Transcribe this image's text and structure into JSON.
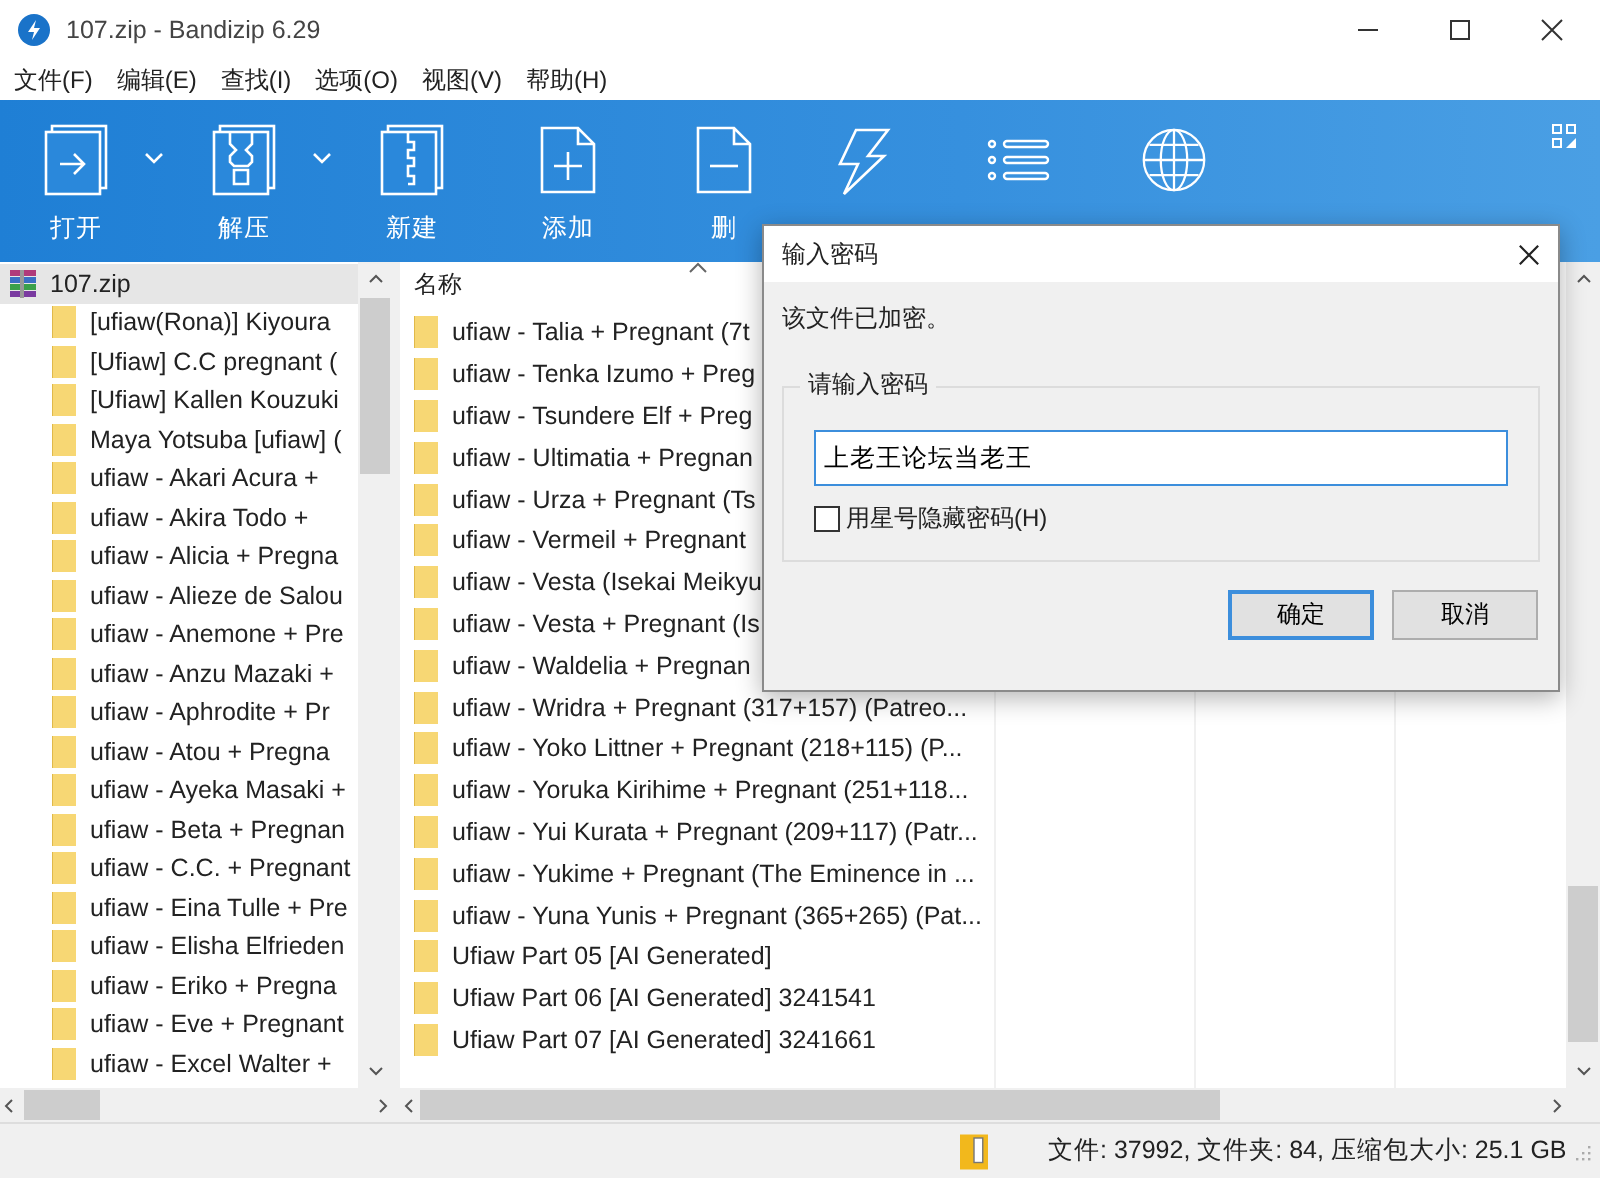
{
  "window": {
    "title": "107.zip - Bandizip 6.29"
  },
  "menu": [
    "文件(F)",
    "编辑(E)",
    "查找(I)",
    "选项(O)",
    "视图(V)",
    "帮助(H)"
  ],
  "toolbar": [
    {
      "label": "打开",
      "has_menu": true
    },
    {
      "label": "解压",
      "has_menu": true
    },
    {
      "label": "新建",
      "has_menu": false
    },
    {
      "label": "添加",
      "has_menu": false
    },
    {
      "label": "删",
      "has_menu": false
    }
  ],
  "tree": {
    "root": {
      "label": "107.zip",
      "selected": true
    },
    "children": [
      {
        "label": "[ufiaw(Rona)] Kiyoura",
        "selected": false
      },
      {
        "label": "[Ufiaw] C.C pregnant (",
        "selected": false
      },
      {
        "label": "[Ufiaw] Kallen Kouzuki",
        "selected": false
      },
      {
        "label": "Maya Yotsuba [ufiaw] (",
        "selected": false
      },
      {
        "label": "ufiaw - Akari Acura +",
        "selected": false
      },
      {
        "label": "ufiaw - Akira Todo +",
        "selected": false
      },
      {
        "label": "ufiaw - Alicia + Pregna",
        "selected": false
      },
      {
        "label": "ufiaw - Alieze de Salou",
        "selected": false
      },
      {
        "label": "ufiaw - Anemone + Pre",
        "selected": false
      },
      {
        "label": "ufiaw - Anzu Mazaki +",
        "selected": false
      },
      {
        "label": "ufiaw - Aphrodite + Pr",
        "selected": false
      },
      {
        "label": "ufiaw - Atou + Pregna",
        "selected": false
      },
      {
        "label": "ufiaw - Ayeka Masaki +",
        "selected": false
      },
      {
        "label": "ufiaw - Beta + Pregnan",
        "selected": false
      },
      {
        "label": "ufiaw - C.C. + Pregnant",
        "selected": false
      },
      {
        "label": "ufiaw - Eina Tulle + Pre",
        "selected": false
      },
      {
        "label": "ufiaw - Elisha Elfrieden",
        "selected": false
      },
      {
        "label": "ufiaw - Eriko + Pregna",
        "selected": false
      },
      {
        "label": "ufiaw - Eve + Pregnant",
        "selected": false
      },
      {
        "label": "ufiaw - Excel Walter +",
        "selected": false
      }
    ]
  },
  "file_list": {
    "columns": [
      "名称"
    ],
    "rows": [
      "ufiaw - Talia + Pregnant (7t",
      "ufiaw - Tenka Izumo + Preg",
      "ufiaw - Tsundere Elf + Preg",
      "ufiaw - Ultimatia + Pregnan",
      "ufiaw - Urza + Pregnant (Ts",
      "ufiaw - Vermeil + Pregnant",
      "ufiaw - Vesta (Isekai Meikyu",
      "ufiaw - Vesta + Pregnant (Is",
      "ufiaw - Waldelia + Pregnan",
      "ufiaw - Wridra + Pregnant (317+157) (Patreo...",
      "ufiaw - Yoko Littner + Pregnant (218+115) (P...",
      "ufiaw - Yoruka Kirihime + Pregnant (251+118...",
      "ufiaw - Yui Kurata + Pregnant (209+117) (Patr...",
      "ufiaw - Yukime + Pregnant (The Eminence in ...",
      "ufiaw - Yuna Yunis + Pregnant (365+265) (Pat...",
      "Ufiaw Part 05 [AI Generated]",
      "Ufiaw Part 06 [AI Generated] 3241541",
      "Ufiaw Part 07 [AI Generated] 3241661"
    ]
  },
  "status_bar": "文件: 37992, 文件夹: 84, 压缩包大小: 25.1 GB",
  "dialog": {
    "title": "输入密码",
    "message": "该文件已加密。",
    "group_label": "请输入密码",
    "password": "上老王论坛当老王",
    "hide_checkbox": {
      "label": "用星号隐藏密码(H)",
      "checked": false
    },
    "buttons": [
      {
        "label": "确定",
        "focused": true
      },
      {
        "label": "取消",
        "focused": false
      }
    ]
  }
}
